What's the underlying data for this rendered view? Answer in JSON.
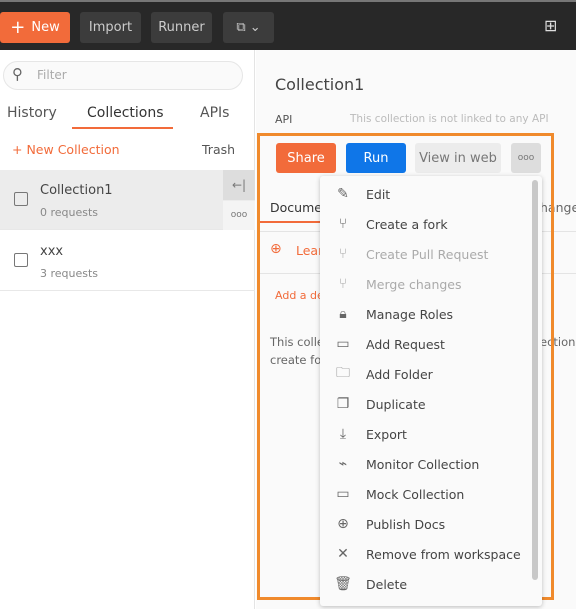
{
  "toolbar": {
    "new": "New",
    "import": "Import",
    "runner": "Runner"
  },
  "sidebar": {
    "filter_placeholder": "Filter",
    "tabs": [
      "History",
      "Collections",
      "APIs"
    ],
    "new_collection": "New Collection",
    "trash": "Trash",
    "collections": [
      {
        "name": "Collection1",
        "requests": "0 requests"
      },
      {
        "name": "xxx",
        "requests": "3 requests"
      }
    ]
  },
  "main": {
    "title": "Collection1",
    "api_label": "API",
    "api_text": "This collection is not linked to any API",
    "share": "Share",
    "run": "Run",
    "view_web": "View in web",
    "tab_doc": "Documer",
    "tab_changes": "hange",
    "learn": "Lear",
    "add_desc": "Add a de",
    "body1": "This colle",
    "body1_end": "ection",
    "body2": "create fol"
  },
  "menu": [
    {
      "label": "Edit",
      "icon": "pencil-icon",
      "disabled": false
    },
    {
      "label": "Create a fork",
      "icon": "fork-icon",
      "disabled": false
    },
    {
      "label": "Create Pull Request",
      "icon": "pull-request-icon",
      "disabled": true
    },
    {
      "label": "Merge changes",
      "icon": "merge-icon",
      "disabled": true
    },
    {
      "label": "Manage Roles",
      "icon": "lock-icon",
      "disabled": false
    },
    {
      "label": "Add Request",
      "icon": "get-request-icon",
      "disabled": false
    },
    {
      "label": "Add Folder",
      "icon": "folder-plus-icon",
      "disabled": false
    },
    {
      "label": "Duplicate",
      "icon": "duplicate-icon",
      "disabled": false
    },
    {
      "label": "Export",
      "icon": "download-icon",
      "disabled": false
    },
    {
      "label": "Monitor Collection",
      "icon": "monitor-icon",
      "disabled": false
    },
    {
      "label": "Mock Collection",
      "icon": "server-icon",
      "disabled": false
    },
    {
      "label": "Publish Docs",
      "icon": "globe-icon",
      "disabled": false
    },
    {
      "label": "Remove from workspace",
      "icon": "close-icon",
      "disabled": false
    },
    {
      "label": "Delete",
      "icon": "trash-icon",
      "disabled": false
    }
  ],
  "colors": {
    "accent": "#f26b3a",
    "run": "#0f76e8",
    "highlight": "#f08a2c"
  }
}
